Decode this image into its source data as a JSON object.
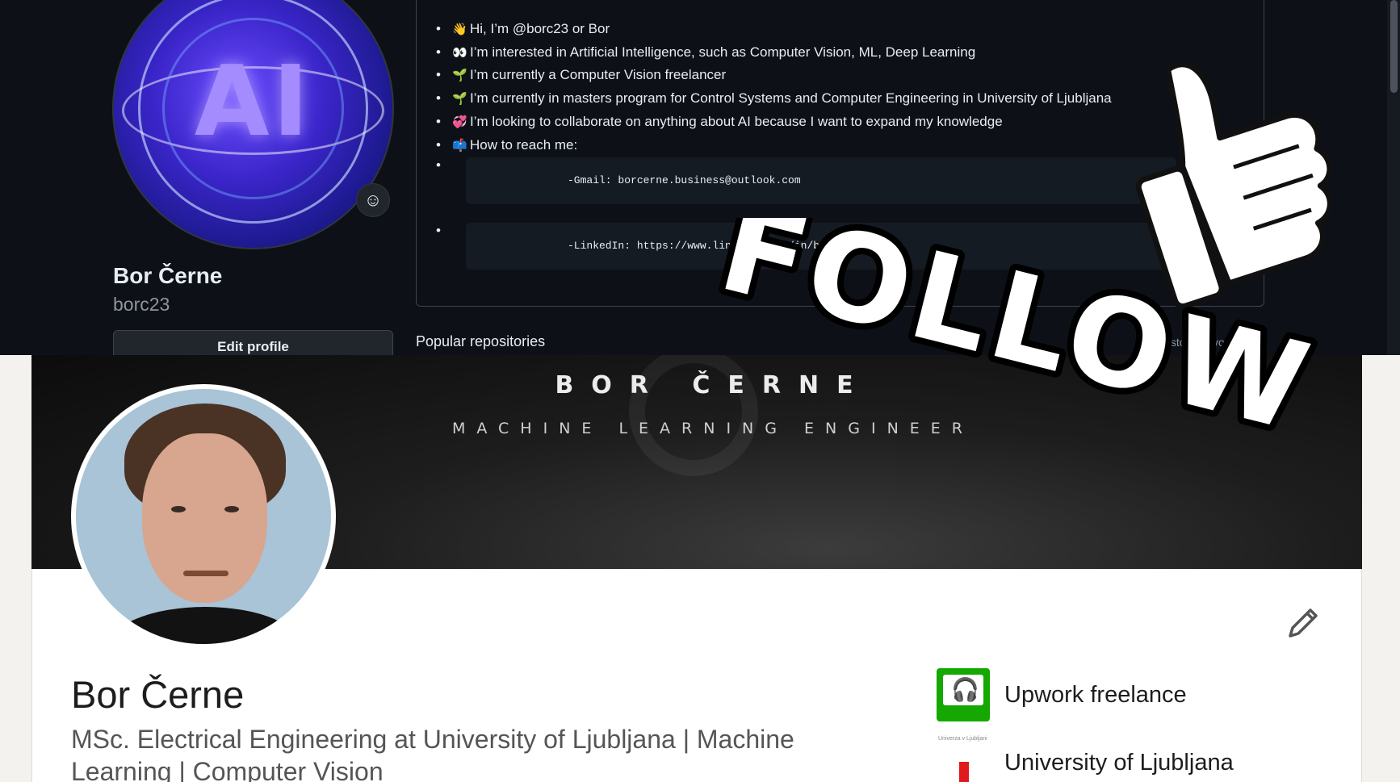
{
  "github": {
    "avatar_text": "AI",
    "status_icon": "smiley-icon",
    "name": "Bor Černe",
    "login": "borc23",
    "edit_profile_label": "Edit profile",
    "readme_items": [
      {
        "icon": "waving-hand-icon",
        "emoji": "👋",
        "text": "Hi, I’m @borc23 or Bor"
      },
      {
        "icon": "eyes-icon",
        "emoji": "👀",
        "text": "I’m interested in Artificial Intelligence, such as Computer Vision, ML, Deep Learning"
      },
      {
        "icon": "seedling-icon",
        "emoji": "🌱",
        "text": "I’m currently a Computer Vision freelancer"
      },
      {
        "icon": "seedling-icon",
        "emoji": "🌱",
        "text": "I’m currently in masters program for Control Systems and Computer Engineering in University of Ljubljana"
      },
      {
        "icon": "hearts-icon",
        "emoji": "💞",
        "text": "I’m looking to collaborate on anything about AI because I want to expand my knowledge"
      },
      {
        "icon": "mailbox-icon",
        "emoji": "📫",
        "text": "How to reach me:"
      }
    ],
    "contact_code": [
      "-Gmail: borcerne.business@outlook.com",
      "-LinkedIn: https://www.linkedin.com/in/borcerne"
    ],
    "popular_repositories_label": "Popular repositories",
    "customize_pins_label": "Customize your pins"
  },
  "linkedin": {
    "banner_name": "BOR ČERNE",
    "banner_title": "MACHINE LEARNING ENGINEER",
    "name": "Bor Černe",
    "headline_line1": "MSc. Electrical Engineering at University of Ljubljana | Machine",
    "headline_line2": "Learning | Computer Vision",
    "affiliations": [
      {
        "icon": "upwork-logo",
        "label": "Upwork freelance"
      },
      {
        "icon": "university-logo",
        "label": "University of Ljubljana",
        "logo_caption": "Univerza v Ljubljani"
      }
    ],
    "edit_icon": "pencil-icon"
  },
  "overlay": {
    "text": "FOLLOW",
    "icon": "thumbs-up-icon"
  },
  "colors": {
    "github_bg": "#0d1117",
    "github_border": "#3d444d",
    "linkedin_card": "#ffffff",
    "linkedin_page": "#f3f2ef",
    "upwork_green": "#14a800",
    "uni_red": "#e0191e"
  }
}
